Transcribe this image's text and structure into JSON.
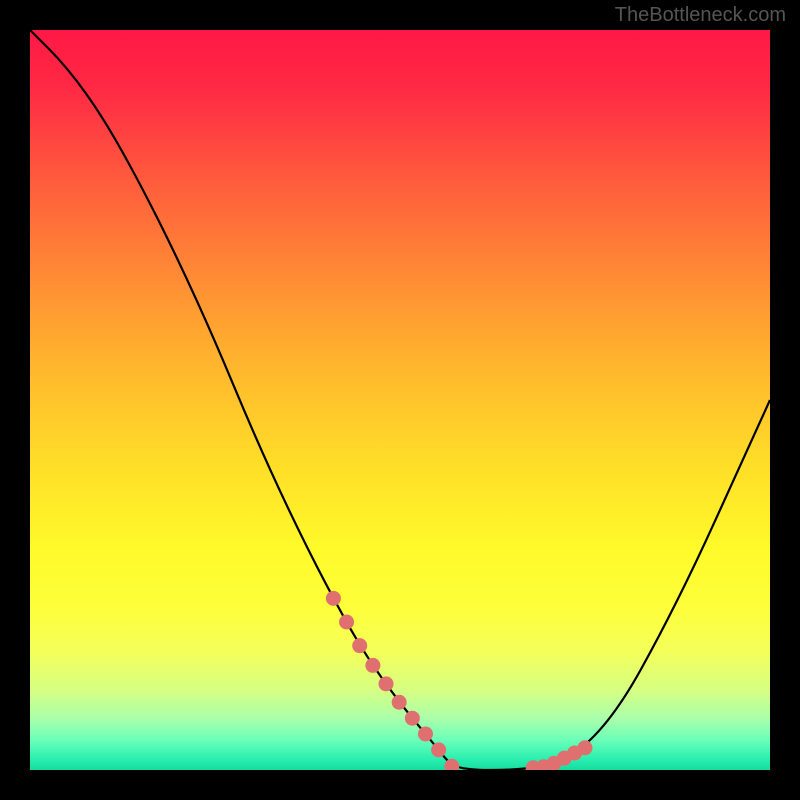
{
  "watermark": "TheBottleneck.com",
  "chart_data": {
    "type": "line",
    "title": "",
    "xlabel": "",
    "ylabel": "",
    "xlim": [
      0,
      100
    ],
    "ylim": [
      0,
      100
    ],
    "series": [
      {
        "name": "curve",
        "x": [
          0,
          5,
          10,
          15,
          20,
          25,
          30,
          35,
          40,
          45,
          50,
          55,
          57,
          60,
          65,
          70,
          75,
          80,
          85,
          90,
          95,
          100
        ],
        "y": [
          100,
          95,
          88,
          79,
          69,
          58,
          46,
          35,
          25,
          16,
          9,
          3,
          0.5,
          0,
          0,
          0.5,
          3,
          9,
          18,
          28,
          39,
          50
        ]
      }
    ],
    "markers": {
      "left_branch": {
        "x_start": 41,
        "x_end": 57,
        "count": 10
      },
      "right_branch": {
        "x_start": 68,
        "x_end": 75,
        "count": 6
      }
    },
    "colors": {
      "curve_stroke": "#000000",
      "marker_fill": "#e07070",
      "gradient_top": "#ff1845",
      "gradient_bottom": "#15dca0"
    }
  }
}
